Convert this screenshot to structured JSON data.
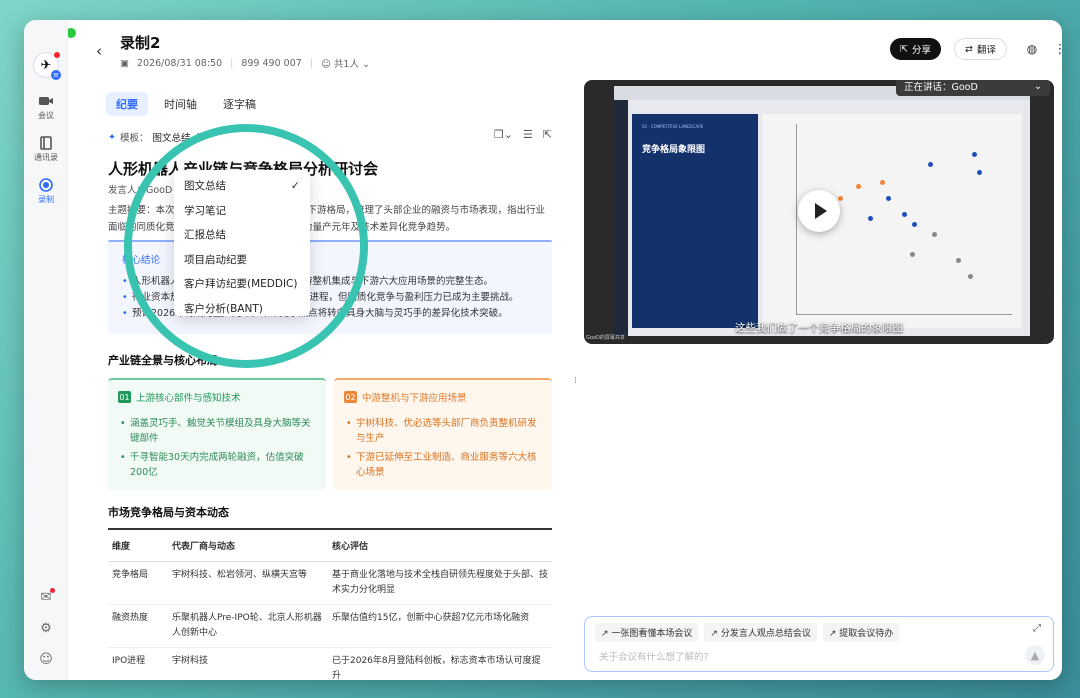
{
  "header": {
    "title": "录制2",
    "date": "2026/08/31 08:50",
    "meeting_id": "899 490 007",
    "participants": "共1人",
    "share_label": "分享",
    "translate_label": "翻译"
  },
  "sidebar": {
    "items": [
      {
        "label": "会议",
        "icon": "video-icon"
      },
      {
        "label": "通讯录",
        "icon": "contacts-icon"
      },
      {
        "label": "录制",
        "icon": "record-icon"
      }
    ]
  },
  "tabs": [
    "纪要",
    "时间轴",
    "逐字稿"
  ],
  "mode": {
    "label": "模板：",
    "selected": "图文总结"
  },
  "dropdown": {
    "items": [
      "图文总结",
      "学习笔记",
      "汇报总结",
      "项目启动纪要",
      "客户拜访纪要(MEDDIC)",
      "客户分析(BANT)"
    ],
    "checked": "图文总结"
  },
  "doc": {
    "title": "人形机器人产业链与竞争格局分析研讨会",
    "speaker": "发言人：GooD",
    "topic": "主题摘要：本次会议梳理了人形机器人产业上中下游格局，梳理了头部企业的融资与市场表现，指出行业面临的同质化竞争与盈利压力，并预测2026年为量产元年及技术差异化竞争趋势。",
    "core_label": "核心结论",
    "core_points": [
      "人形机器人产业链覆盖上游核心部件、中游整机集成与下游六大应用场景的完整生态。",
      "行业资本热度持续攀升，头部厂商加速IPO进程，但同质化竞争与盈利压力已成为主要挑战。",
      "预计2026年将成为量产元年，未来竞争焦点将转向具身大脑与灵巧手的差异化技术突破。"
    ]
  },
  "section1": {
    "title": "产业链全景与核心布局",
    "cards": [
      {
        "num": "01",
        "title": "上游核心部件与感知技术",
        "points": [
          "涵盖灵巧手、触觉关节模组及具身大脑等关键部件",
          "千寻智能30天内完成两轮融资，估值突破200亿"
        ]
      },
      {
        "num": "02",
        "title": "中游整机与下游应用场景",
        "points": [
          "宇树科技、优必选等头部厂商负责整机研发与生产",
          "下游已延伸至工业制造、商业服务等六大核心场景"
        ]
      }
    ]
  },
  "section2": {
    "title": "市场竞争格局与资本动态",
    "headers": [
      "维度",
      "代表厂商与动态",
      "核心评估"
    ],
    "rows": [
      [
        "竞争格局",
        "宇树科技、松岩领河、纵横天宫等",
        "基于商业化落地与技术全栈自研领先程度处于头部、技术实力分化明显"
      ],
      [
        "融资热度",
        "乐聚机器人Pre-IPO轮、北京人形机器人创新中心",
        "乐聚估值约15亿，创新中心获超7亿元市场化融资"
      ],
      [
        "IPO进程",
        "宇树科技",
        "已于2026年8月登陆科创板，标志资本市场认可度提升"
      ]
    ]
  },
  "video": {
    "speaking": "正在讲话：GooD",
    "subtitle": "这些我们做了一个竞争格局的象限图",
    "panel_title": "竞争格局象限图",
    "panel_sub": "02 · COMPETITIVE LANDSCAPE",
    "tag": "GooD的屏幕共享"
  },
  "chat": {
    "chips": [
      "一张图看懂本场会议",
      "分发言人观点总结会议",
      "提取会议待办"
    ],
    "placeholder": "关于会议有什么想了解的?"
  },
  "colors": {
    "accent": "#2f6bff",
    "highlight_circle": "#38c4b0",
    "green": "#1f9a5a",
    "orange": "#f0883b"
  }
}
